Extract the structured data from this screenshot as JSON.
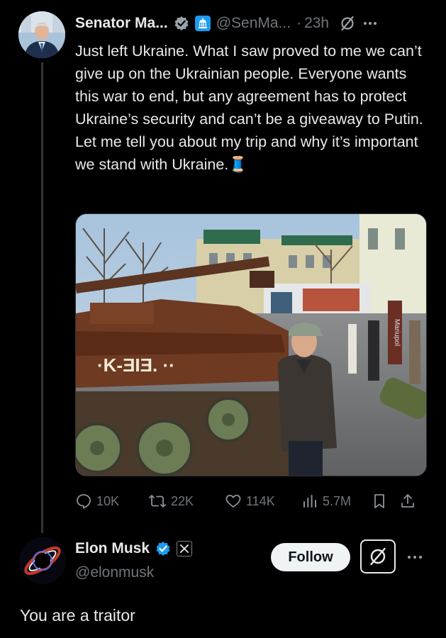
{
  "tweet": {
    "author_name": "Senator Ma...",
    "handle": "@SenMa...",
    "separator": "·",
    "time": "23h",
    "text": "Just left Ukraine. What I saw proved to me we can’t give up on the Ukrainian people. Everyone wants this war to end, but any agreement has to protect Ukraine’s security and can’t be a giveaway to Putin. Let me tell you about my trip and why it’s important we stand with Ukraine.",
    "emoji": "🧵",
    "photo_sign_text": "Mariupol",
    "icons": [
      "verified-icon",
      "government-badge-icon",
      "grok-icon",
      "more-icon"
    ],
    "actions": {
      "replies": "10K",
      "reposts": "22K",
      "likes": "114K",
      "views": "5.7M"
    }
  },
  "reply": {
    "author_name": "Elon Musk",
    "handle": "@elonmusk",
    "follow_label": "Follow",
    "text": "You are a traitor",
    "icons": [
      "verified-icon",
      "x-affiliate-icon",
      "grok-icon",
      "more-icon"
    ]
  },
  "colors": {
    "background": "#000000",
    "text": "#e7e9ea",
    "muted": "#71767b",
    "verified": "#1d9bf0"
  }
}
